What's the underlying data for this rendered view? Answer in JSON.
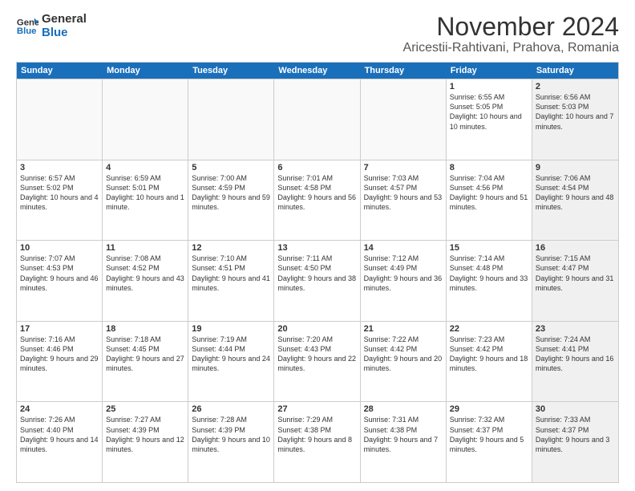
{
  "logo": {
    "line1": "General",
    "line2": "Blue"
  },
  "header": {
    "month": "November 2024",
    "location": "Aricestii-Rahtivani, Prahova, Romania"
  },
  "weekdays": [
    "Sunday",
    "Monday",
    "Tuesday",
    "Wednesday",
    "Thursday",
    "Friday",
    "Saturday"
  ],
  "rows": [
    [
      {
        "day": "",
        "info": "",
        "shaded": false,
        "empty": true
      },
      {
        "day": "",
        "info": "",
        "shaded": false,
        "empty": true
      },
      {
        "day": "",
        "info": "",
        "shaded": false,
        "empty": true
      },
      {
        "day": "",
        "info": "",
        "shaded": false,
        "empty": true
      },
      {
        "day": "",
        "info": "",
        "shaded": false,
        "empty": true
      },
      {
        "day": "1",
        "info": "Sunrise: 6:55 AM\nSunset: 5:05 PM\nDaylight: 10 hours and 10 minutes.",
        "shaded": false,
        "empty": false
      },
      {
        "day": "2",
        "info": "Sunrise: 6:56 AM\nSunset: 5:03 PM\nDaylight: 10 hours and 7 minutes.",
        "shaded": true,
        "empty": false
      }
    ],
    [
      {
        "day": "3",
        "info": "Sunrise: 6:57 AM\nSunset: 5:02 PM\nDaylight: 10 hours and 4 minutes.",
        "shaded": false,
        "empty": false
      },
      {
        "day": "4",
        "info": "Sunrise: 6:59 AM\nSunset: 5:01 PM\nDaylight: 10 hours and 1 minute.",
        "shaded": false,
        "empty": false
      },
      {
        "day": "5",
        "info": "Sunrise: 7:00 AM\nSunset: 4:59 PM\nDaylight: 9 hours and 59 minutes.",
        "shaded": false,
        "empty": false
      },
      {
        "day": "6",
        "info": "Sunrise: 7:01 AM\nSunset: 4:58 PM\nDaylight: 9 hours and 56 minutes.",
        "shaded": false,
        "empty": false
      },
      {
        "day": "7",
        "info": "Sunrise: 7:03 AM\nSunset: 4:57 PM\nDaylight: 9 hours and 53 minutes.",
        "shaded": false,
        "empty": false
      },
      {
        "day": "8",
        "info": "Sunrise: 7:04 AM\nSunset: 4:56 PM\nDaylight: 9 hours and 51 minutes.",
        "shaded": false,
        "empty": false
      },
      {
        "day": "9",
        "info": "Sunrise: 7:06 AM\nSunset: 4:54 PM\nDaylight: 9 hours and 48 minutes.",
        "shaded": true,
        "empty": false
      }
    ],
    [
      {
        "day": "10",
        "info": "Sunrise: 7:07 AM\nSunset: 4:53 PM\nDaylight: 9 hours and 46 minutes.",
        "shaded": false,
        "empty": false
      },
      {
        "day": "11",
        "info": "Sunrise: 7:08 AM\nSunset: 4:52 PM\nDaylight: 9 hours and 43 minutes.",
        "shaded": false,
        "empty": false
      },
      {
        "day": "12",
        "info": "Sunrise: 7:10 AM\nSunset: 4:51 PM\nDaylight: 9 hours and 41 minutes.",
        "shaded": false,
        "empty": false
      },
      {
        "day": "13",
        "info": "Sunrise: 7:11 AM\nSunset: 4:50 PM\nDaylight: 9 hours and 38 minutes.",
        "shaded": false,
        "empty": false
      },
      {
        "day": "14",
        "info": "Sunrise: 7:12 AM\nSunset: 4:49 PM\nDaylight: 9 hours and 36 minutes.",
        "shaded": false,
        "empty": false
      },
      {
        "day": "15",
        "info": "Sunrise: 7:14 AM\nSunset: 4:48 PM\nDaylight: 9 hours and 33 minutes.",
        "shaded": false,
        "empty": false
      },
      {
        "day": "16",
        "info": "Sunrise: 7:15 AM\nSunset: 4:47 PM\nDaylight: 9 hours and 31 minutes.",
        "shaded": true,
        "empty": false
      }
    ],
    [
      {
        "day": "17",
        "info": "Sunrise: 7:16 AM\nSunset: 4:46 PM\nDaylight: 9 hours and 29 minutes.",
        "shaded": false,
        "empty": false
      },
      {
        "day": "18",
        "info": "Sunrise: 7:18 AM\nSunset: 4:45 PM\nDaylight: 9 hours and 27 minutes.",
        "shaded": false,
        "empty": false
      },
      {
        "day": "19",
        "info": "Sunrise: 7:19 AM\nSunset: 4:44 PM\nDaylight: 9 hours and 24 minutes.",
        "shaded": false,
        "empty": false
      },
      {
        "day": "20",
        "info": "Sunrise: 7:20 AM\nSunset: 4:43 PM\nDaylight: 9 hours and 22 minutes.",
        "shaded": false,
        "empty": false
      },
      {
        "day": "21",
        "info": "Sunrise: 7:22 AM\nSunset: 4:42 PM\nDaylight: 9 hours and 20 minutes.",
        "shaded": false,
        "empty": false
      },
      {
        "day": "22",
        "info": "Sunrise: 7:23 AM\nSunset: 4:42 PM\nDaylight: 9 hours and 18 minutes.",
        "shaded": false,
        "empty": false
      },
      {
        "day": "23",
        "info": "Sunrise: 7:24 AM\nSunset: 4:41 PM\nDaylight: 9 hours and 16 minutes.",
        "shaded": true,
        "empty": false
      }
    ],
    [
      {
        "day": "24",
        "info": "Sunrise: 7:26 AM\nSunset: 4:40 PM\nDaylight: 9 hours and 14 minutes.",
        "shaded": false,
        "empty": false
      },
      {
        "day": "25",
        "info": "Sunrise: 7:27 AM\nSunset: 4:39 PM\nDaylight: 9 hours and 12 minutes.",
        "shaded": false,
        "empty": false
      },
      {
        "day": "26",
        "info": "Sunrise: 7:28 AM\nSunset: 4:39 PM\nDaylight: 9 hours and 10 minutes.",
        "shaded": false,
        "empty": false
      },
      {
        "day": "27",
        "info": "Sunrise: 7:29 AM\nSunset: 4:38 PM\nDaylight: 9 hours and 8 minutes.",
        "shaded": false,
        "empty": false
      },
      {
        "day": "28",
        "info": "Sunrise: 7:31 AM\nSunset: 4:38 PM\nDaylight: 9 hours and 7 minutes.",
        "shaded": false,
        "empty": false
      },
      {
        "day": "29",
        "info": "Sunrise: 7:32 AM\nSunset: 4:37 PM\nDaylight: 9 hours and 5 minutes.",
        "shaded": false,
        "empty": false
      },
      {
        "day": "30",
        "info": "Sunrise: 7:33 AM\nSunset: 4:37 PM\nDaylight: 9 hours and 3 minutes.",
        "shaded": true,
        "empty": false
      }
    ]
  ]
}
